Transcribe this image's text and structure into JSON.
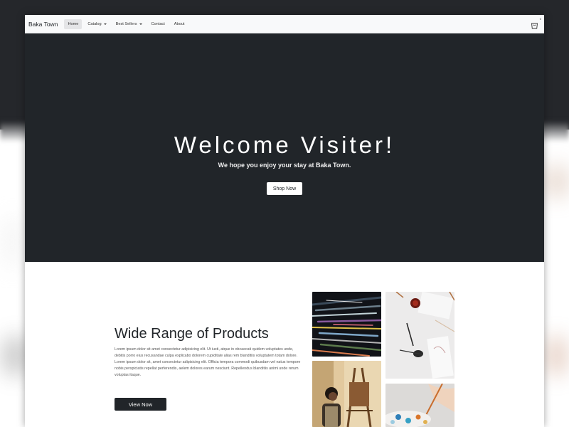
{
  "navbar": {
    "brand": "Baka Town",
    "links": [
      {
        "label": "Home",
        "active": true
      },
      {
        "label": "Catalog",
        "dropdown": true
      },
      {
        "label": "Best Sellers",
        "dropdown": true
      },
      {
        "label": "Contact"
      },
      {
        "label": "About"
      }
    ],
    "cart_icon": "shopping-bag-icon",
    "cart_count": "0"
  },
  "hero": {
    "title": "Welcome Visiter!",
    "subtitle": "We hope you enjoy your stay at Baka Town.",
    "button_label": "Shop Now"
  },
  "products": {
    "title": "Wide Range of Products",
    "body": "Lorem ipsum dolor sit amet consectetur adipisicing elit. Ut iusti, atque in obcaecati quidem voluptates unde, debitis porro eius recusandae culpa explicabo dolorem cupiditate alias rem blanditiis voluptatem totam dolore. Lorem ipsum dolor sit, amet consectetur adipisicing elit. Officia tempora commodi quibusdam vel natus tempore nobis perspiciatis repellat perferendis, aelem dolores earum nesciunt. Repellendus blanditiis animi unde rerum voluptas itaque.",
    "button_label": "View Now",
    "images": [
      "paint-brushes-image",
      "paint-ink-image",
      "artist-easel-image",
      "palette-image"
    ]
  },
  "colors": {
    "dark": "#212529",
    "navbar_bg": "#f8f9fa"
  }
}
